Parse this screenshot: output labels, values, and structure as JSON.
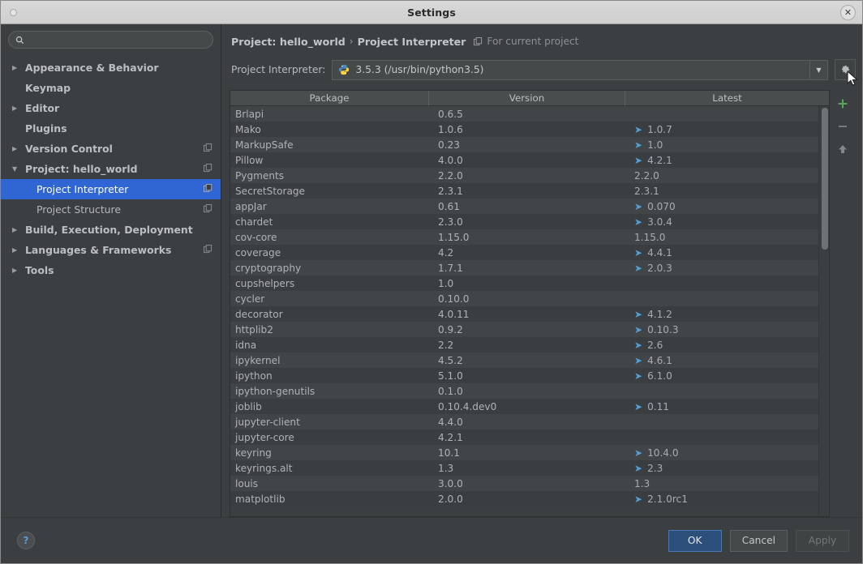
{
  "window": {
    "title": "Settings",
    "close_icon": "close-icon"
  },
  "sidebar": {
    "search": {
      "value": "",
      "placeholder": "",
      "icon": "search-icon"
    },
    "items": [
      {
        "label": "Appearance & Behavior",
        "arrow": "▶",
        "level": 0,
        "bold": true,
        "selected": false,
        "module_icon": false
      },
      {
        "label": "Keymap",
        "arrow": "",
        "level": 0,
        "bold": true,
        "selected": false,
        "module_icon": false
      },
      {
        "label": "Editor",
        "arrow": "▶",
        "level": 0,
        "bold": true,
        "selected": false,
        "module_icon": false
      },
      {
        "label": "Plugins",
        "arrow": "",
        "level": 0,
        "bold": true,
        "selected": false,
        "module_icon": false
      },
      {
        "label": "Version Control",
        "arrow": "▶",
        "level": 0,
        "bold": true,
        "selected": false,
        "module_icon": true
      },
      {
        "label": "Project: hello_world",
        "arrow": "▼",
        "level": 0,
        "bold": true,
        "selected": false,
        "module_icon": true
      },
      {
        "label": "Project Interpreter",
        "arrow": "",
        "level": 1,
        "bold": false,
        "selected": true,
        "module_icon": true
      },
      {
        "label": "Project Structure",
        "arrow": "",
        "level": 1,
        "bold": false,
        "selected": false,
        "module_icon": true
      },
      {
        "label": "Build, Execution, Deployment",
        "arrow": "▶",
        "level": 0,
        "bold": true,
        "selected": false,
        "module_icon": false
      },
      {
        "label": "Languages & Frameworks",
        "arrow": "▶",
        "level": 0,
        "bold": true,
        "selected": false,
        "module_icon": true
      },
      {
        "label": "Tools",
        "arrow": "▶",
        "level": 0,
        "bold": true,
        "selected": false,
        "module_icon": false
      }
    ]
  },
  "main": {
    "breadcrumb": {
      "root": "Project: hello_world",
      "separator": "›",
      "leaf": "Project Interpreter",
      "note": "For current project",
      "note_icon": "module-icon"
    },
    "interpreter": {
      "label": "Project Interpreter:",
      "value": "3.5.3 (/usr/bin/python3.5)",
      "icon": "python-icon",
      "dropdown_icon": "chevron-down-icon",
      "gear_icon": "gear-icon"
    },
    "tools": {
      "add": "+",
      "remove": "−",
      "upgrade": "↑"
    },
    "table": {
      "columns": [
        "Package",
        "Version",
        "Latest"
      ],
      "rows": [
        {
          "package": "Brlapi",
          "version": "0.6.5",
          "latest": "",
          "upgradable": false
        },
        {
          "package": "Mako",
          "version": "1.0.6",
          "latest": "1.0.7",
          "upgradable": true
        },
        {
          "package": "MarkupSafe",
          "version": "0.23",
          "latest": "1.0",
          "upgradable": true
        },
        {
          "package": "Pillow",
          "version": "4.0.0",
          "latest": "4.2.1",
          "upgradable": true
        },
        {
          "package": "Pygments",
          "version": "2.2.0",
          "latest": "2.2.0",
          "upgradable": false
        },
        {
          "package": "SecretStorage",
          "version": "2.3.1",
          "latest": "2.3.1",
          "upgradable": false
        },
        {
          "package": "appJar",
          "version": "0.61",
          "latest": "0.070",
          "upgradable": true
        },
        {
          "package": "chardet",
          "version": "2.3.0",
          "latest": "3.0.4",
          "upgradable": true
        },
        {
          "package": "cov-core",
          "version": "1.15.0",
          "latest": "1.15.0",
          "upgradable": false
        },
        {
          "package": "coverage",
          "version": "4.2",
          "latest": "4.4.1",
          "upgradable": true
        },
        {
          "package": "cryptography",
          "version": "1.7.1",
          "latest": "2.0.3",
          "upgradable": true
        },
        {
          "package": "cupshelpers",
          "version": "1.0",
          "latest": "",
          "upgradable": false
        },
        {
          "package": "cycler",
          "version": "0.10.0",
          "latest": "",
          "upgradable": false
        },
        {
          "package": "decorator",
          "version": "4.0.11",
          "latest": "4.1.2",
          "upgradable": true
        },
        {
          "package": "httplib2",
          "version": "0.9.2",
          "latest": "0.10.3",
          "upgradable": true
        },
        {
          "package": "idna",
          "version": "2.2",
          "latest": "2.6",
          "upgradable": true
        },
        {
          "package": "ipykernel",
          "version": "4.5.2",
          "latest": "4.6.1",
          "upgradable": true
        },
        {
          "package": "ipython",
          "version": "5.1.0",
          "latest": "6.1.0",
          "upgradable": true
        },
        {
          "package": "ipython-genutils",
          "version": "0.1.0",
          "latest": "",
          "upgradable": false
        },
        {
          "package": "joblib",
          "version": "0.10.4.dev0",
          "latest": "0.11",
          "upgradable": true
        },
        {
          "package": "jupyter-client",
          "version": "4.4.0",
          "latest": "",
          "upgradable": false
        },
        {
          "package": "jupyter-core",
          "version": "4.2.1",
          "latest": "",
          "upgradable": false
        },
        {
          "package": "keyring",
          "version": "10.1",
          "latest": "10.4.0",
          "upgradable": true
        },
        {
          "package": "keyrings.alt",
          "version": "1.3",
          "latest": "2.3",
          "upgradable": true
        },
        {
          "package": "louis",
          "version": "3.0.0",
          "latest": "1.3",
          "upgradable": false
        },
        {
          "package": "matplotlib",
          "version": "2.0.0",
          "latest": "2.1.0rc1",
          "upgradable": true
        }
      ]
    }
  },
  "footer": {
    "help": "?",
    "ok": "OK",
    "cancel": "Cancel",
    "apply": "Apply"
  },
  "colors": {
    "selection_blue": "#2f66d4",
    "upgrade_arrow": "#4f9fd8",
    "add_green": "#58a55c",
    "primary_button": "#2d4f7c"
  }
}
